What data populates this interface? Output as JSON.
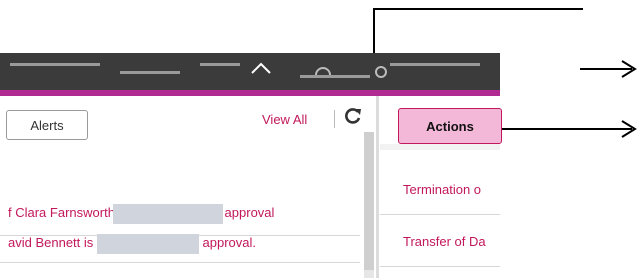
{
  "alerts_panel": {
    "tab_label": "Alerts",
    "view_all_label": "View All",
    "items": [
      {
        "text_before": "f Clara Farnsworth",
        "text_after": "approval"
      },
      {
        "text_before": "avid Bennett is",
        "text_after": "approval."
      }
    ]
  },
  "actions_panel": {
    "button_label": "Actions",
    "items": [
      {
        "text": "Termination o"
      },
      {
        "text": "Transfer of Da"
      }
    ]
  },
  "colors": {
    "accent": "#c2185b",
    "topbar": "#3b3b3b",
    "pink_bar": "#b02a92",
    "actions_bg": "#f3b7d8"
  }
}
